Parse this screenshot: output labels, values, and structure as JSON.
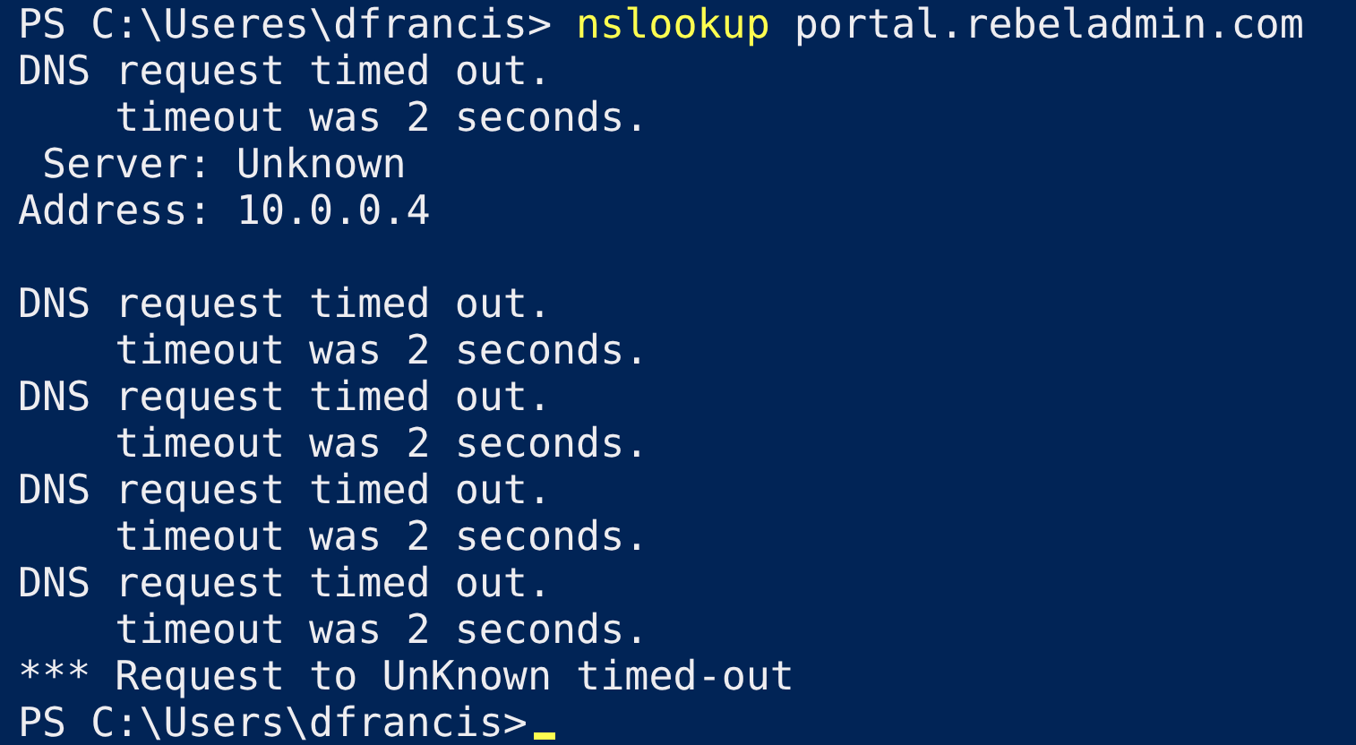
{
  "console": {
    "lines": [
      {
        "kind": "command",
        "prompt": "PS C:\\Useres\\dfrancis>",
        "command": "nslookup",
        "argument": "portal.rebeladmin.com"
      },
      {
        "kind": "output",
        "text": "DNS request timed out."
      },
      {
        "kind": "output",
        "text": "    timeout was 2 seconds."
      },
      {
        "kind": "output",
        "text": " Server: Unknown"
      },
      {
        "kind": "output",
        "text": "Address: 10.0.0.4"
      },
      {
        "kind": "blank"
      },
      {
        "kind": "output",
        "text": "DNS request timed out."
      },
      {
        "kind": "output",
        "text": "    timeout was 2 seconds."
      },
      {
        "kind": "output",
        "text": "DNS request timed out."
      },
      {
        "kind": "output",
        "text": "    timeout was 2 seconds."
      },
      {
        "kind": "output",
        "text": "DNS request timed out."
      },
      {
        "kind": "output",
        "text": "    timeout was 2 seconds."
      },
      {
        "kind": "output",
        "text": "DNS request timed out."
      },
      {
        "kind": "output",
        "text": "    timeout was 2 seconds."
      },
      {
        "kind": "output",
        "text": "*** Request to UnKnown timed-out"
      },
      {
        "kind": "prompt",
        "prompt": "PS C:\\Users\\dfrancis>",
        "cursor": true
      }
    ]
  }
}
